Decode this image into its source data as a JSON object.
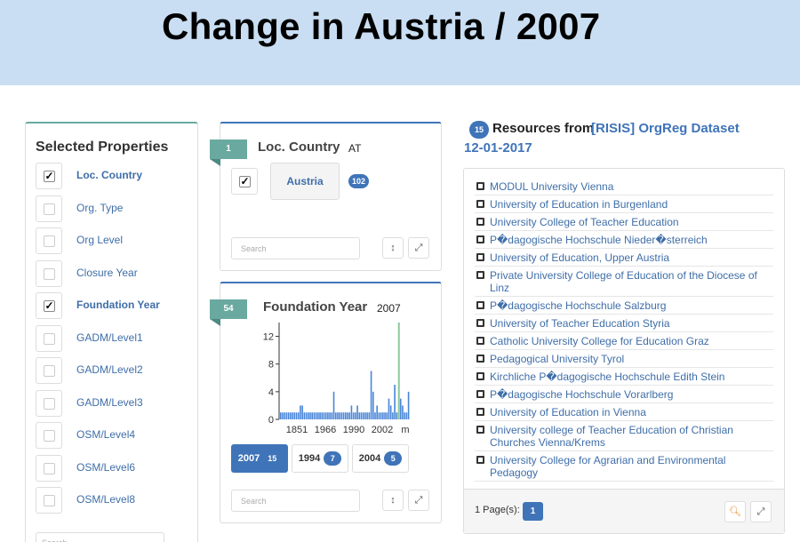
{
  "banner": {
    "title": "Change in Austria / 2007"
  },
  "properties": {
    "title": "Selected Properties",
    "search_placeholder": "Search",
    "items": [
      {
        "label": "Loc. Country",
        "checked": true
      },
      {
        "label": "Org. Type",
        "checked": false
      },
      {
        "label": "Org Level",
        "checked": false
      },
      {
        "label": "Closure Year",
        "checked": false
      },
      {
        "label": "Foundation Year",
        "checked": true
      },
      {
        "label": "GADM/Level1",
        "checked": false
      },
      {
        "label": "GADM/Level2",
        "checked": false
      },
      {
        "label": "GADM/Level3",
        "checked": false
      },
      {
        "label": "OSM/Level4",
        "checked": false
      },
      {
        "label": "OSM/Level6",
        "checked": false
      },
      {
        "label": "OSM/Level8",
        "checked": false
      }
    ]
  },
  "country_facet": {
    "count": "1",
    "title": "Loc. Country",
    "value": "AT",
    "chip_label": "Austria",
    "chip_count": "102",
    "search_placeholder": "Search"
  },
  "year_facet": {
    "count": "54",
    "title": "Foundation Year",
    "value": "2007",
    "search_placeholder": "Search",
    "buttons": [
      {
        "year": "2007",
        "count": "15",
        "active": true
      },
      {
        "year": "1994",
        "count": "7",
        "active": false
      },
      {
        "year": "2004",
        "count": "5",
        "active": false
      }
    ]
  },
  "chart_data": {
    "type": "bar",
    "yticks": [
      "12",
      "8",
      "4",
      "0"
    ],
    "xticks": [
      "1851",
      "1966",
      "1990",
      "2002",
      "m"
    ],
    "ylim": [
      0,
      14
    ],
    "values": [
      1,
      1,
      1,
      1,
      1,
      1,
      1,
      1,
      1,
      1,
      2,
      2,
      1,
      1,
      1,
      1,
      1,
      1,
      1,
      1,
      1,
      1,
      1,
      1,
      1,
      1,
      1,
      4,
      1,
      1,
      1,
      1,
      1,
      1,
      1,
      1,
      2,
      1,
      1,
      2,
      1,
      1,
      1,
      1,
      1,
      1,
      7,
      4,
      1,
      2,
      1,
      1,
      1,
      1,
      1,
      3,
      2,
      1,
      5,
      1,
      1,
      3,
      2,
      1,
      1,
      4
    ],
    "highlight_index": 60,
    "highlight_value": 14,
    "bar_color": "#4a86d8",
    "highlight_color": "#8bc79a"
  },
  "resources": {
    "count": "15",
    "heading": "Resources from",
    "source_link": "[RISIS] OrgReg Dataset",
    "date": "12-01-2017",
    "items": [
      "MODUL University Vienna",
      "University of Education in Burgenland",
      "University College of Teacher Education",
      "P�dagogische Hochschule Nieder�sterreich",
      "University of Education, Upper Austria",
      "Private University College of Education of the Diocese of Linz",
      "P�dagogische Hochschule Salzburg",
      "University of Teacher Education Styria",
      "Catholic University College for Education Graz",
      "Pedagogical University Tyrol",
      "Kirchliche P�dagogische Hochschule Edith Stein",
      "P�dagogische Hochschule Vorarlberg",
      "University of Education in Vienna",
      "University college of Teacher Education of Christian Churches Vienna/Krems",
      "University College for Agrarian and Environmental Pedagogy"
    ],
    "pages_label": "1 Page(s):",
    "current_page": "1"
  }
}
